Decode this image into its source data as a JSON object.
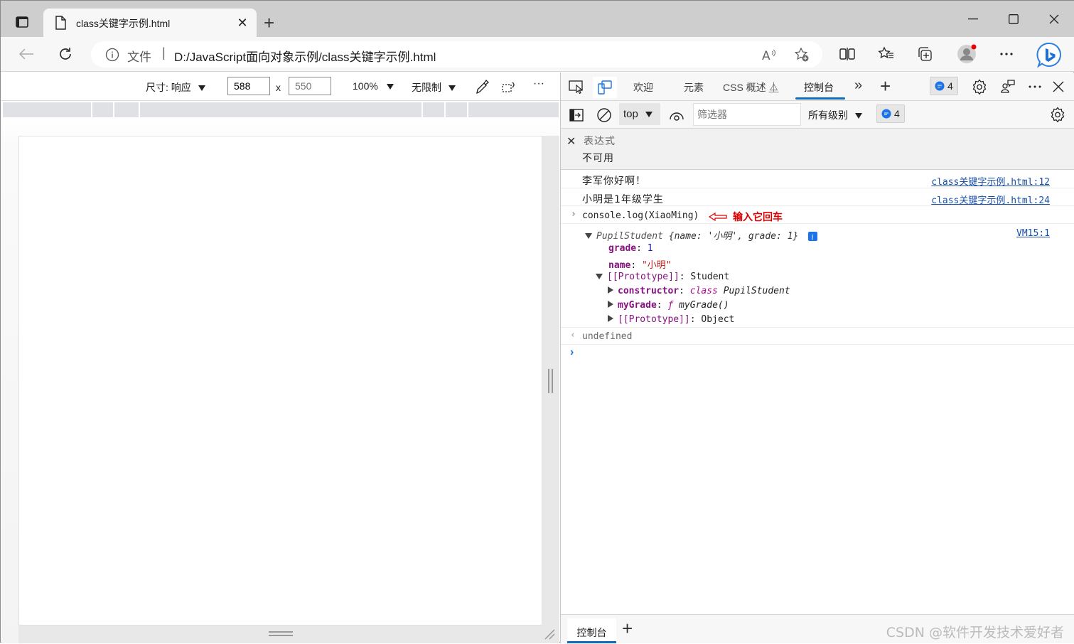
{
  "browser": {
    "tab_title": "class关键字示例.html",
    "new_tab_label": "+",
    "address": {
      "scheme_label": "文件",
      "separator": "|",
      "url": "D:/JavaScript面向对象示例/class关键字示例.html"
    }
  },
  "device_toolbar": {
    "dimensions_label": "尺寸: 响应",
    "width_value": "588",
    "times": "x",
    "height_placeholder": "550",
    "zoom": "100%",
    "throttle": "无限制",
    "more": "···"
  },
  "devtools": {
    "tabs": [
      {
        "label": "欢迎"
      },
      {
        "label": "元素"
      },
      {
        "label": "CSS 概述"
      },
      {
        "label": "控制台",
        "active": true
      }
    ],
    "more_tabs": "»",
    "add_tab": "+",
    "issues_count": "4",
    "console_toolbar": {
      "context": "top",
      "filter_placeholder": "筛选器",
      "levels": "所有级别",
      "issues_count": "4"
    },
    "live_expression": {
      "label": "表达式",
      "value": "不可用"
    },
    "messages": [
      {
        "text": "李军你好啊！",
        "source": "class关键字示例.html:12"
      },
      {
        "text": "小明是1年级学生",
        "source": "class关键字示例.html:24"
      }
    ],
    "input_command": "console.log(XiaoMing)",
    "annotation": "输入它回车",
    "object": {
      "summary_class": "PupilStudent",
      "summary_props": "{name: '小明', grade: 1}",
      "source": "VM15:1",
      "grade_key": "grade",
      "grade_value": "1",
      "name_key": "name",
      "name_value": "\"小明\"",
      "proto_label": "[[Prototype]]",
      "proto_value": "Student",
      "constructor_key": "constructor",
      "constructor_kw": "class",
      "constructor_value": "PupilStudent",
      "method_key": "myGrade",
      "method_f": "ƒ",
      "method_value": "myGrade()",
      "proto2_label": "[[Prototype]]",
      "proto2_value": "Object"
    },
    "return_value": "undefined",
    "drawer_tab": "控制台",
    "drawer_add": "+"
  },
  "watermark": "CSDN @软件开发技术爱好者"
}
